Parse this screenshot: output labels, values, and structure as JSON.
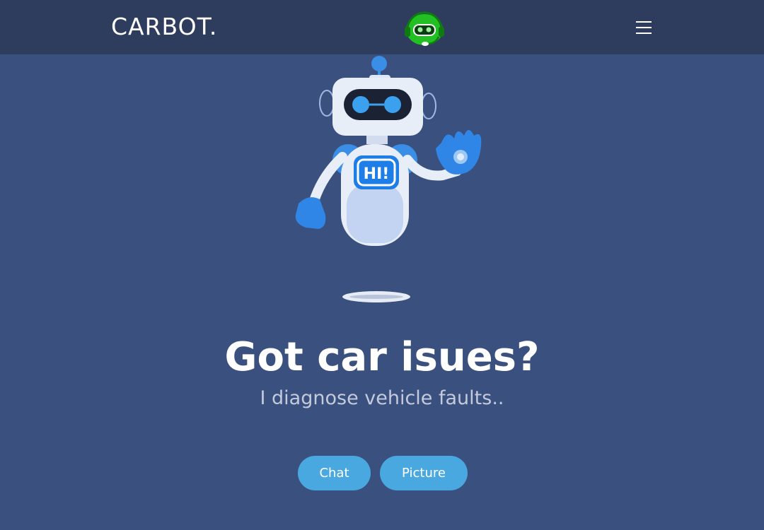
{
  "nav": {
    "brand": "CARBOT.",
    "logo_icon": "robot-headset-icon",
    "menu_icon": "hamburger-menu-icon"
  },
  "hero": {
    "illustration": "waving-robot-illustration",
    "badge_text": "HI!",
    "title": "Got car isues?",
    "subtitle": "I diagnose vehicle faults.."
  },
  "actions": {
    "chat_label": "Chat",
    "picture_label": "Picture"
  },
  "colors": {
    "background": "#3a5180",
    "navbar": "#2e3d5e",
    "button": "#4aa8e0",
    "logo_green": "#22c022",
    "subtitle": "#c4cadb"
  }
}
